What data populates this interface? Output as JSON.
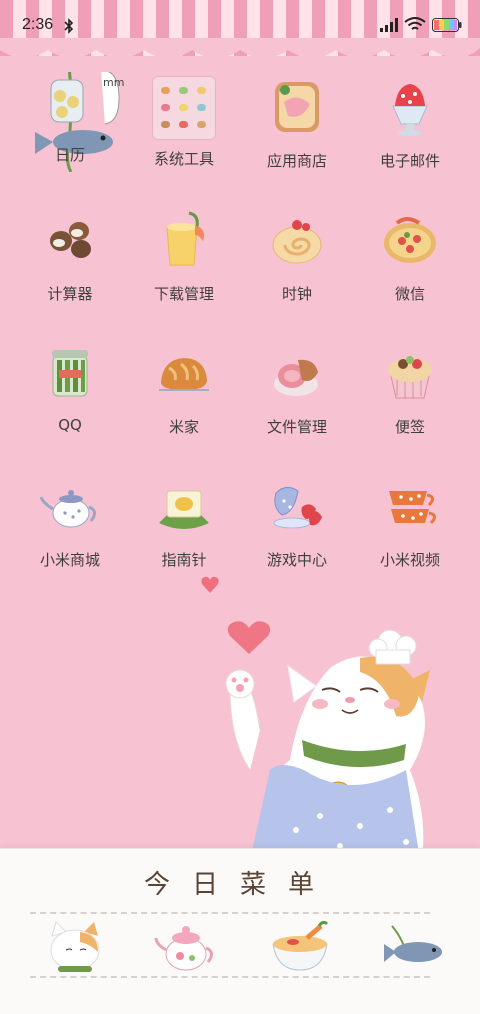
{
  "status": {
    "time": "2:36"
  },
  "apps": [
    {
      "label": "日历",
      "icon": "calendar-jar-fish-icon"
    },
    {
      "label": "系统工具",
      "icon": "system-tools-folder-icon"
    },
    {
      "label": "应用商店",
      "icon": "toast-icon"
    },
    {
      "label": "电子邮件",
      "icon": "strawberry-sundae-icon"
    },
    {
      "label": "计算器",
      "icon": "macarons-icon"
    },
    {
      "label": "下载管理",
      "icon": "juice-glass-icon"
    },
    {
      "label": "时钟",
      "icon": "swiss-roll-icon"
    },
    {
      "label": "微信",
      "icon": "pizza-tart-icon"
    },
    {
      "label": "QQ",
      "icon": "pickle-jar-icon"
    },
    {
      "label": "米家",
      "icon": "bread-loaf-icon"
    },
    {
      "label": "文件管理",
      "icon": "ham-icon"
    },
    {
      "label": "便签",
      "icon": "cupcake-icon"
    },
    {
      "label": "小米商城",
      "icon": "teapot-icon"
    },
    {
      "label": "指南针",
      "icon": "cake-slice-icon"
    },
    {
      "label": "游戏中心",
      "icon": "teacup-strawberry-icon"
    },
    {
      "label": "小米视频",
      "icon": "coffee-cups-icon"
    }
  ],
  "calendar_bubble": "mmp",
  "menu": {
    "title": "今日菜单",
    "dock": [
      {
        "icon": "cat-face-icon"
      },
      {
        "icon": "pink-teapot-icon"
      },
      {
        "icon": "noodle-bowl-icon"
      },
      {
        "icon": "fish-icon"
      }
    ]
  },
  "colors": {
    "background": "#f7c3d2",
    "awning_pink": "#ef9fb7",
    "awning_light": "#ffe2ea",
    "card": "#fbfaf8"
  }
}
